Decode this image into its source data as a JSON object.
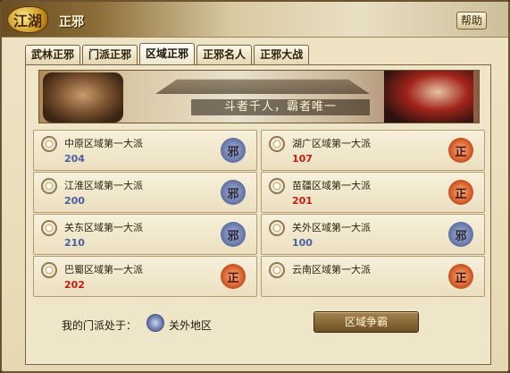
{
  "window": {
    "title": "正邪",
    "logo_text": "江湖",
    "help_label": "帮助"
  },
  "tabs": [
    {
      "label": "武林正邪",
      "active": false
    },
    {
      "label": "门派正邪",
      "active": false
    },
    {
      "label": "区域正邪",
      "active": true
    },
    {
      "label": "正邪名人",
      "active": false
    },
    {
      "label": "正邪大战",
      "active": false
    }
  ],
  "banner": {
    "slogan": "斗者千人，霸者唯一"
  },
  "regions": [
    {
      "name": "中原区域第一大派",
      "count": "204",
      "count_color": "blue",
      "faction": "邪",
      "faction_type": "evil"
    },
    {
      "name": "湖广区域第一大派",
      "count": "107",
      "count_color": "red",
      "faction": "正",
      "faction_type": "good"
    },
    {
      "name": "江淮区域第一大派",
      "count": "200",
      "count_color": "blue",
      "faction": "邪",
      "faction_type": "evil"
    },
    {
      "name": "苗疆区域第一大派",
      "count": "201",
      "count_color": "red",
      "faction": "正",
      "faction_type": "good"
    },
    {
      "name": "关东区域第一大派",
      "count": "210",
      "count_color": "blue",
      "faction": "邪",
      "faction_type": "evil"
    },
    {
      "name": "关外区域第一大派",
      "count": "100",
      "count_color": "blue",
      "faction": "邪",
      "faction_type": "evil"
    },
    {
      "name": "巴蜀区域第一大派",
      "count": "202",
      "count_color": "red",
      "faction": "正",
      "faction_type": "good"
    },
    {
      "name": "云南区域第一大派",
      "count": "",
      "count_color": "red",
      "faction": "正",
      "faction_type": "good"
    }
  ],
  "footer": {
    "label": "我的门派处于：",
    "region": "关外地区",
    "action_label": "区域争霸"
  },
  "colors": {
    "evil": "#6f7faf",
    "good": "#d9622d",
    "count_blue": "#4a5fa0",
    "count_red": "#c01d12"
  }
}
